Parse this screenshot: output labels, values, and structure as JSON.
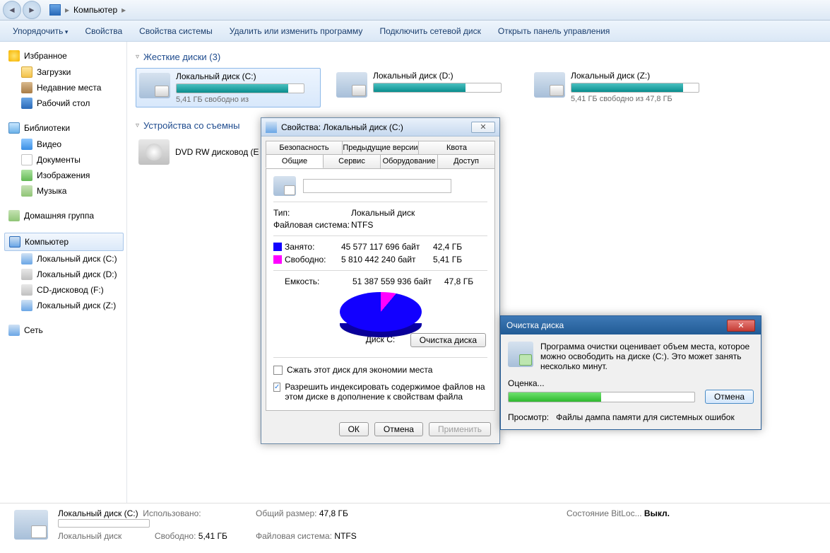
{
  "address": {
    "root": "Компьютер"
  },
  "toolbar": {
    "organize": "Упорядочить",
    "properties": "Свойства",
    "sys_properties": "Свойства системы",
    "uninstall": "Удалить или изменить программу",
    "map_drive": "Подключить сетевой диск",
    "control_panel": "Открыть панель управления"
  },
  "sidebar": {
    "favorites": "Избранное",
    "downloads": "Загрузки",
    "recent": "Недавние места",
    "desktop": "Рабочий стол",
    "libraries": "Библиотеки",
    "video": "Видео",
    "documents": "Документы",
    "images": "Изображения",
    "music": "Музыка",
    "homegroup": "Домашняя группа",
    "computer": "Компьютер",
    "driveC": "Локальный диск (C:)",
    "driveD": "Локальный диск (D:)",
    "driveCD": "CD-дисковод (F:)",
    "driveZ": "Локальный диск (Z:)",
    "network": "Сеть"
  },
  "content": {
    "hdd_header": "Жесткие диски (3)",
    "removable_header": "Устройства со съемны",
    "drives": [
      {
        "name": "Локальный диск (C:)",
        "free": "5,41 ГБ свободно из",
        "fill": 88
      },
      {
        "name": "Локальный диск (D:)",
        "free": "",
        "fill": 72
      },
      {
        "name": "Локальный диск (Z:)",
        "free": "5,41 ГБ свободно из 47,8 ГБ",
        "fill": 88
      }
    ],
    "dvd": "DVD RW дисковод (E"
  },
  "props": {
    "title": "Свойства: Локальный диск (C:)",
    "tabs_top": [
      "Безопасность",
      "Предыдущие версии",
      "Квота"
    ],
    "tabs_bot": [
      "Общие",
      "Сервис",
      "Оборудование",
      "Доступ"
    ],
    "type_lbl": "Тип:",
    "type_val": "Локальный диск",
    "fs_lbl": "Файловая система:",
    "fs_val": "NTFS",
    "used_lbl": "Занято:",
    "used_bytes": "45 577 117 696 байт",
    "used_gb": "42,4 ГБ",
    "free_lbl": "Свободно:",
    "free_bytes": "5 810 442 240 байт",
    "free_gb": "5,41 ГБ",
    "cap_lbl": "Емкость:",
    "cap_bytes": "51 387 559 936 байт",
    "cap_gb": "47,8 ГБ",
    "pie_label": "Диск C:",
    "cleanup_btn": "Очистка диска",
    "compress": "Сжать этот диск для экономии места",
    "index": "Разрешить индексировать содержимое файлов на этом диске в дополнение к свойствам файла",
    "ok": "ОК",
    "cancel": "Отмена",
    "apply": "Применить"
  },
  "cleanup": {
    "title": "Очистка диска",
    "msg": "Программа очистки оценивает объем места, которое можно освободить на диске  (C:). Это может занять несколько минут.",
    "evaluating": "Оценка...",
    "cancel": "Отмена",
    "view_lbl": "Просмотр:",
    "view_val": "Файлы дампа памяти для системных ошибок"
  },
  "status": {
    "name": "Локальный диск (C:)",
    "kind": "Локальный диск",
    "used_lbl": "Использовано:",
    "free_lbl": "Свободно:",
    "free_val": "5,41 ГБ",
    "size_lbl": "Общий размер:",
    "size_val": "47,8 ГБ",
    "fs_lbl": "Файловая система:",
    "fs_val": "NTFS",
    "bitlocker_lbl": "Состояние BitLoc...",
    "bitlocker_val": "Выкл."
  }
}
